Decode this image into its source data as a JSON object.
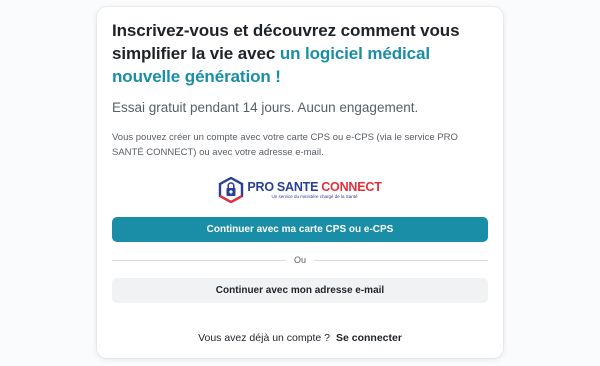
{
  "signup": {
    "headline_part1": "Inscrivez-vous et découvrez comment vous simplifier la vie avec ",
    "headline_accent": "un logiciel médical nouvelle génération !",
    "subtitle": "Essai gratuit pendant 14 jours. Aucun engagement.",
    "description": "Vous pouvez créer un compte avec votre carte CPS ou e-CPS (via le service PRO SANTÉ CONNECT) ou avec votre adresse e-mail.",
    "logo": {
      "brand_pro": "PRO",
      "brand_sante": "SANTE",
      "brand_connect": "CONNECT",
      "tagline": "Un service du ministère chargé de la Santé"
    },
    "cps_button_label": "Continuer avec ma carte CPS ou e-CPS",
    "divider_label": "Ou",
    "email_button_label": "Continuer avec mon adresse e-mail",
    "login_question": "Vous avez déjà un compte ?",
    "login_link": "Se connecter"
  },
  "colors": {
    "accent": "#1a8ea6",
    "text": "#1f2328",
    "muted": "#596066",
    "psc_blue": "#2a3f95",
    "psc_red": "#e2313a"
  }
}
